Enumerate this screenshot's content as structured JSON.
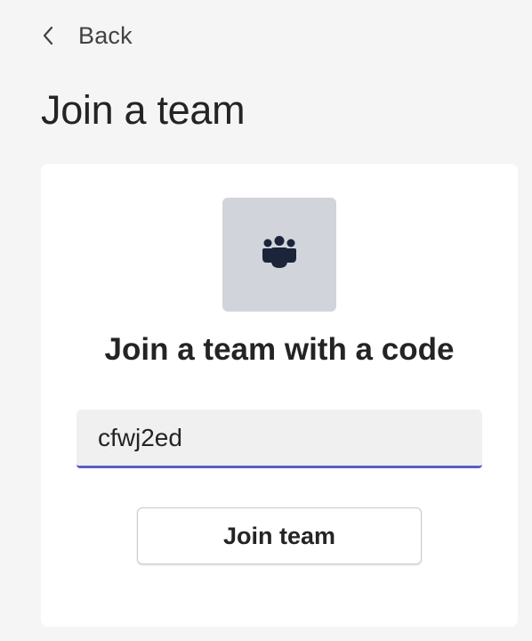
{
  "nav": {
    "back_label": "Back",
    "back_icon": "chevron-left-icon"
  },
  "page": {
    "title": "Join a team"
  },
  "card": {
    "icon": "people-team-icon",
    "heading": "Join a team with a code",
    "code_input_value": "cfwj2ed",
    "join_button_label": "Join team"
  },
  "colors": {
    "background": "#f5f5f5",
    "card": "#ffffff",
    "tile": "#d1d5db",
    "icon": "#1b2438",
    "accent_underline": "#5b5fc7",
    "spellcheck": "#e0483a"
  }
}
